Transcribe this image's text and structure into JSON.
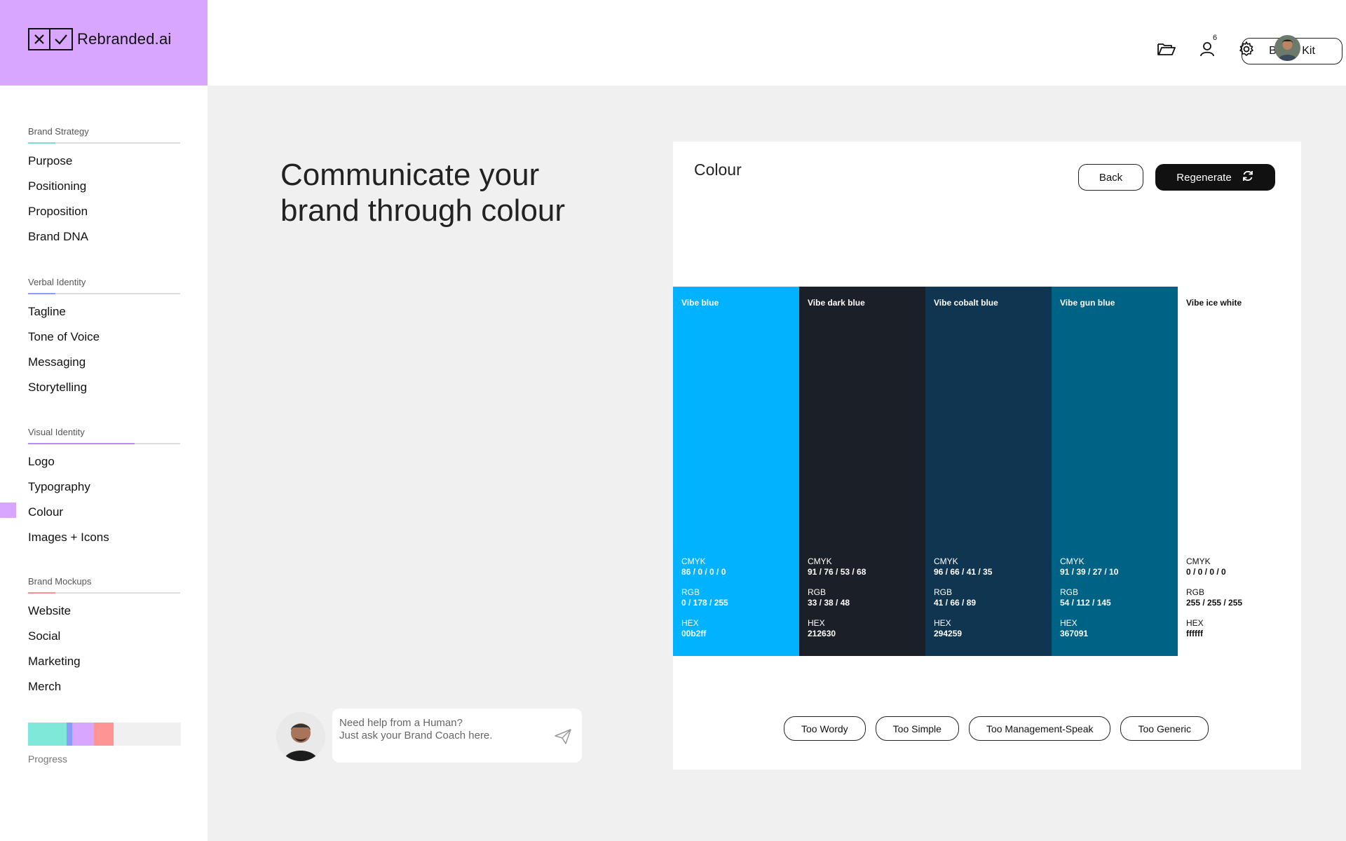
{
  "app": {
    "logo_text": "Rebranded.ai"
  },
  "sidebar": {
    "sections": [
      {
        "title": "Brand Strategy",
        "accent": "#7fe0c8",
        "items": [
          "Purpose",
          "Positioning",
          "Proposition",
          "Brand DNA"
        ]
      },
      {
        "title": "Verbal Identity",
        "accent": "#8a9cff",
        "items": [
          "Tagline",
          "Tone of Voice",
          "Messaging",
          "Storytelling"
        ]
      },
      {
        "title": "Visual Identity",
        "accent": "#b98aff",
        "items": [
          "Logo",
          "Typography",
          "Colour",
          "Images + Icons"
        ]
      },
      {
        "title": "Brand Mockups",
        "accent": "#ff8e8e",
        "items": [
          "Website",
          "Social",
          "Marketing",
          "Merch"
        ]
      }
    ],
    "active_item": "Colour",
    "progress_label": "Progress",
    "progress_segments": [
      {
        "color": "#7fe8d8",
        "fraction": 0.25
      },
      {
        "color": "#8a9cff",
        "fraction": 0.04
      },
      {
        "color": "#d9a6ff",
        "fraction": 0.14
      },
      {
        "color": "#ff9494",
        "fraction": 0.13
      }
    ]
  },
  "header": {
    "brand_kit_label": "Brand Kit",
    "notification_count": "6",
    "icons": [
      "folder-icon",
      "user-icon",
      "settings-icon",
      "avatar"
    ]
  },
  "main": {
    "headline": "Communicate your brand through colour",
    "coach": {
      "line1": "Need help from a Human?",
      "line2": "Just ask your Brand Coach here."
    },
    "card": {
      "title": "Colour",
      "back_label": "Back",
      "regenerate_label": "Regenerate",
      "swatches": [
        {
          "name": "Vibe blue",
          "bg": "#00b2ff",
          "fg": "#ffffff",
          "cmyk": "86 / 0 / 0 / 0",
          "rgb": "0 / 178 / 255",
          "hex": "00b2ff"
        },
        {
          "name": "Vibe dark blue",
          "bg": "#1b1f28",
          "fg": "#ffffff",
          "cmyk": "91 / 76 / 53 / 68",
          "rgb": "33 / 38 / 48",
          "hex": "212630"
        },
        {
          "name": "Vibe cobalt blue",
          "bg": "#0f3550",
          "fg": "#ffffff",
          "cmyk": "96 / 66 / 41 / 35",
          "rgb": "41 / 66 / 89",
          "hex": "294259"
        },
        {
          "name": "Vibe gun blue",
          "bg": "#006285",
          "fg": "#ffffff",
          "cmyk": "91 / 39 / 27 / 10",
          "rgb": "54 / 112 / 145",
          "hex": "367091"
        },
        {
          "name": "Vibe ice white",
          "bg": "#ffffff",
          "fg": "#111111",
          "cmyk": "0 / 0 / 0 / 0",
          "rgb": "255 / 255 / 255",
          "hex": "ffffff"
        }
      ],
      "spec_labels": {
        "cmyk": "CMYK",
        "rgb": "RGB",
        "hex": "HEX"
      },
      "feedback_chips": [
        "Too Wordy",
        "Too Simple",
        "Too Management-Speak",
        "Too Generic"
      ]
    }
  }
}
